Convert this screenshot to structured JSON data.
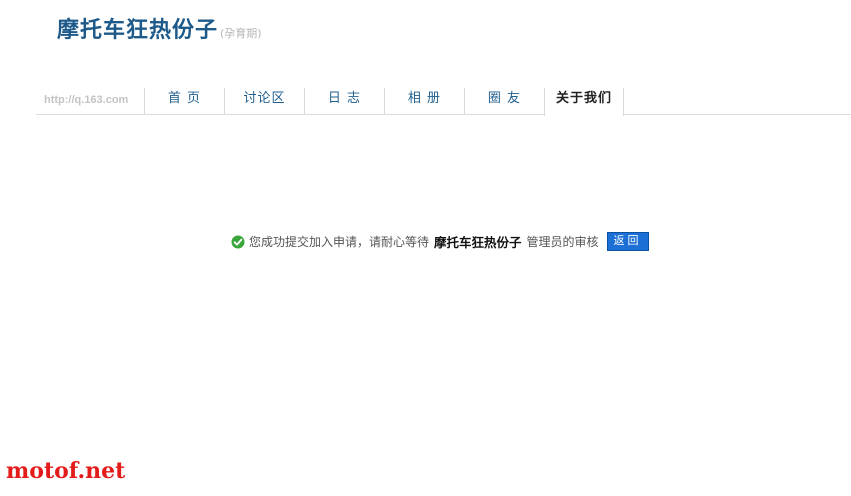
{
  "header": {
    "group_name": "摩托车狂热份子",
    "group_stage": "(孕育期)"
  },
  "nav": {
    "site_url": "http://q.163.com",
    "tabs": [
      {
        "label": "首 页",
        "active": false
      },
      {
        "label": "讨论区",
        "active": false
      },
      {
        "label": "日 志",
        "active": false
      },
      {
        "label": "相 册",
        "active": false
      },
      {
        "label": "圈 友",
        "active": false
      },
      {
        "label": "关于我们",
        "active": true
      }
    ]
  },
  "message": {
    "before": "您成功提交加入申请，请耐心等待",
    "group_name": "摩托车狂热份子",
    "after": "管理员的审核",
    "back_label": "返回",
    "icon": "check-circle-icon"
  },
  "colors": {
    "title": "#1d5a8a",
    "nav_text": "#1f5f8f",
    "button_bg": "#1c6fd4",
    "check_green": "#3aa53a",
    "watermark": "#e41b1b"
  },
  "watermark": "motof.net"
}
